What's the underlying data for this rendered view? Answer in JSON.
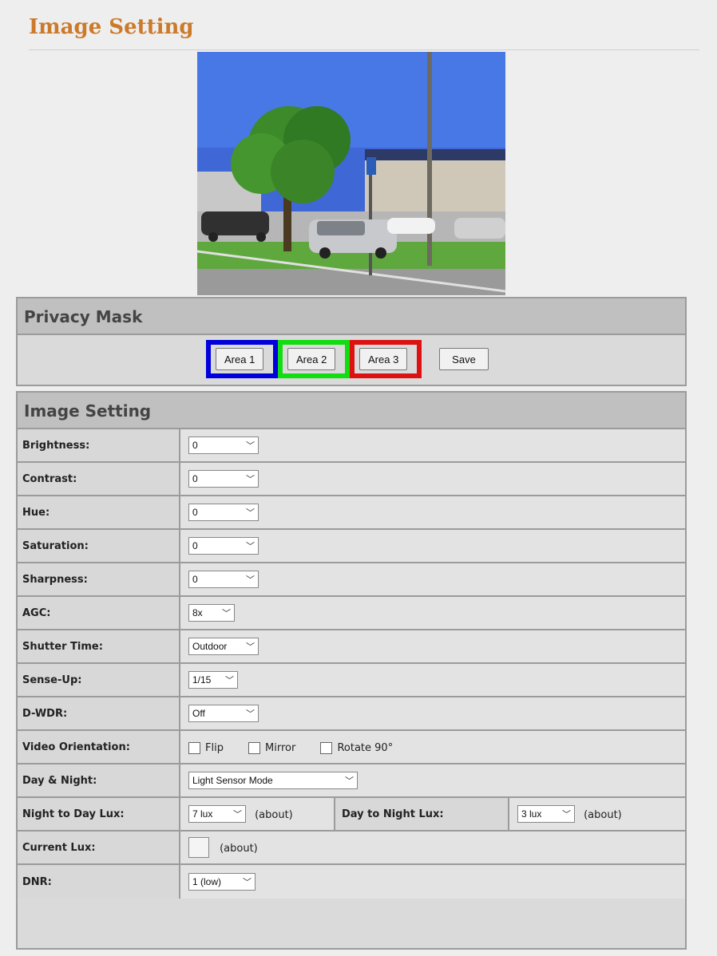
{
  "page": {
    "title": "Image Setting"
  },
  "privacy_mask": {
    "heading": "Privacy Mask",
    "areas": [
      {
        "label": "Area 1",
        "color": "#0000dd"
      },
      {
        "label": "Area 2",
        "color": "#11dd11"
      },
      {
        "label": "Area 3",
        "color": "#dd1111"
      }
    ],
    "save_label": "Save"
  },
  "image_setting": {
    "heading": "Image Setting",
    "brightness": {
      "label": "Brightness:",
      "value": "0"
    },
    "contrast": {
      "label": "Contrast:",
      "value": "0"
    },
    "hue": {
      "label": "Hue:",
      "value": "0"
    },
    "saturation": {
      "label": "Saturation:",
      "value": "0"
    },
    "sharpness": {
      "label": "Sharpness:",
      "value": "0"
    },
    "agc": {
      "label": "AGC:",
      "value": "8x"
    },
    "shutter_time": {
      "label": "Shutter Time:",
      "value": "Outdoor"
    },
    "sense_up": {
      "label": "Sense-Up:",
      "value": "1/15"
    },
    "dwdr": {
      "label": "D-WDR:",
      "value": "Off"
    },
    "video_orientation": {
      "label": "Video Orientation:",
      "flip": "Flip",
      "mirror": "Mirror",
      "rotate": "Rotate 90°"
    },
    "day_night": {
      "label": "Day & Night:",
      "value": "Light Sensor Mode"
    },
    "night_to_day": {
      "label": "Night to Day Lux:",
      "value": "7 lux",
      "suffix": "(about)"
    },
    "day_to_night": {
      "label": "Day to Night Lux:",
      "value": "3 lux",
      "suffix": "(about)"
    },
    "current_lux": {
      "label": "Current Lux:",
      "suffix": "(about)"
    },
    "dnr": {
      "label": "DNR:",
      "value": "1 (low)"
    }
  }
}
